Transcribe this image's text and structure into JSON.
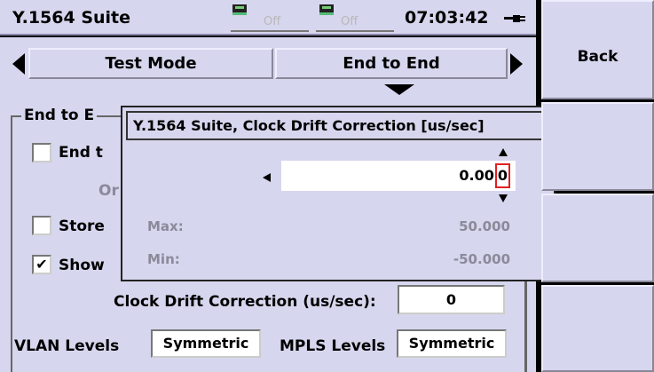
{
  "header": {
    "app_title": "Y.1564 Suite",
    "port1_status": "Off",
    "port2_status": "Off",
    "clock": "07:03:42"
  },
  "mode_row": {
    "label": "Test Mode",
    "value": "End to End"
  },
  "group": {
    "title": "End to E",
    "row1_label": "End t",
    "row1_checked": "",
    "or_label": "Or",
    "row2_label": "Store",
    "row2_checked": "",
    "row3_label": "Show",
    "row3_checked": "✔",
    "clock_drift_label": "Clock Drift Correction (us/sec):",
    "clock_drift_value": "0",
    "vlan_label": "VLAN Levels",
    "vlan_value": "Symmetric",
    "mpls_label": "MPLS Levels",
    "mpls_value": "Symmetric"
  },
  "dialog": {
    "title": "Y.1564 Suite, Clock Drift Correction [us/sec]",
    "value_prefix": "0.00",
    "value_cursor": "0",
    "max_label": "Max:",
    "max_value": "50.000",
    "min_label": "Min:",
    "min_value": "-50.000"
  },
  "softkeys": {
    "back_label": "Back",
    "key2_label": "",
    "key3_label": "",
    "key4_label": ""
  },
  "colors": {
    "panel_bg": "#d6d6ee",
    "cursor_border": "#e02020",
    "disabled_text": "#8a8a9a"
  }
}
